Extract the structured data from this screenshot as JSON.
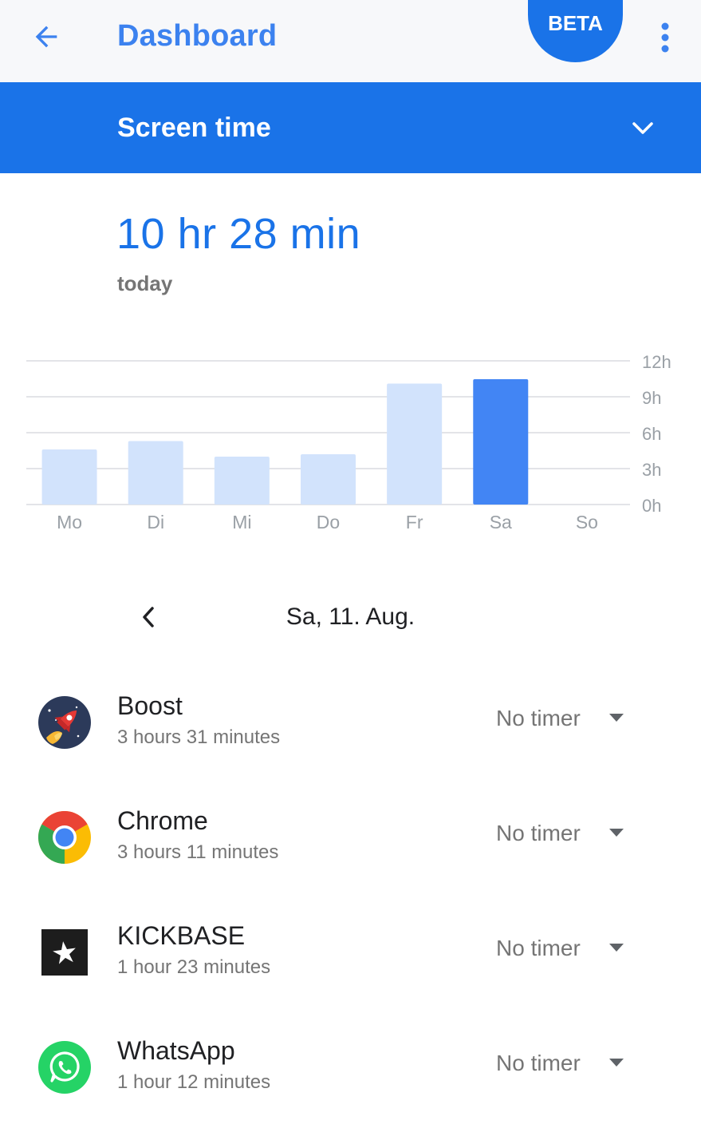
{
  "header": {
    "title": "Dashboard",
    "beta_badge": "BETA",
    "back_icon": "arrow-back-icon",
    "menu_icon": "more-vert-icon"
  },
  "section": {
    "title": "Screen time",
    "expand_icon": "chevron-down-icon"
  },
  "summary": {
    "total": "10 hr 28 min",
    "period": "today"
  },
  "chart_data": {
    "type": "bar",
    "categories": [
      "Mo",
      "Di",
      "Mi",
      "Do",
      "Fr",
      "Sa",
      "So"
    ],
    "values": [
      4.6,
      5.3,
      4.0,
      4.2,
      10.1,
      10.47,
      0
    ],
    "highlight_index": 5,
    "y_ticks": [
      "12h",
      "9h",
      "6h",
      "3h",
      "0h"
    ],
    "ylim": [
      0,
      12
    ],
    "grid": true,
    "colors": {
      "bar": "#d2e3fc",
      "highlight": "#4285f4",
      "grid": "#dadce0",
      "label": "#9aa0a6"
    }
  },
  "date_nav": {
    "label": "Sa, 11. Aug.",
    "prev_icon": "chevron-left-icon"
  },
  "apps": [
    {
      "name": "Boost",
      "time": "3 hours 31 minutes",
      "timer": "No timer",
      "icon": "boost-rocket-icon"
    },
    {
      "name": "Chrome",
      "time": "3 hours 11 minutes",
      "timer": "No timer",
      "icon": "chrome-icon"
    },
    {
      "name": "KICKBASE",
      "time": "1 hour 23 minutes",
      "timer": "No timer",
      "icon": "kickbase-icon"
    },
    {
      "name": "WhatsApp",
      "time": "1 hour 12 minutes",
      "timer": "No timer",
      "icon": "whatsapp-icon"
    }
  ],
  "colors": {
    "accent": "#1a73e8",
    "title": "#3c82ef",
    "secondary_text": "#757575"
  }
}
